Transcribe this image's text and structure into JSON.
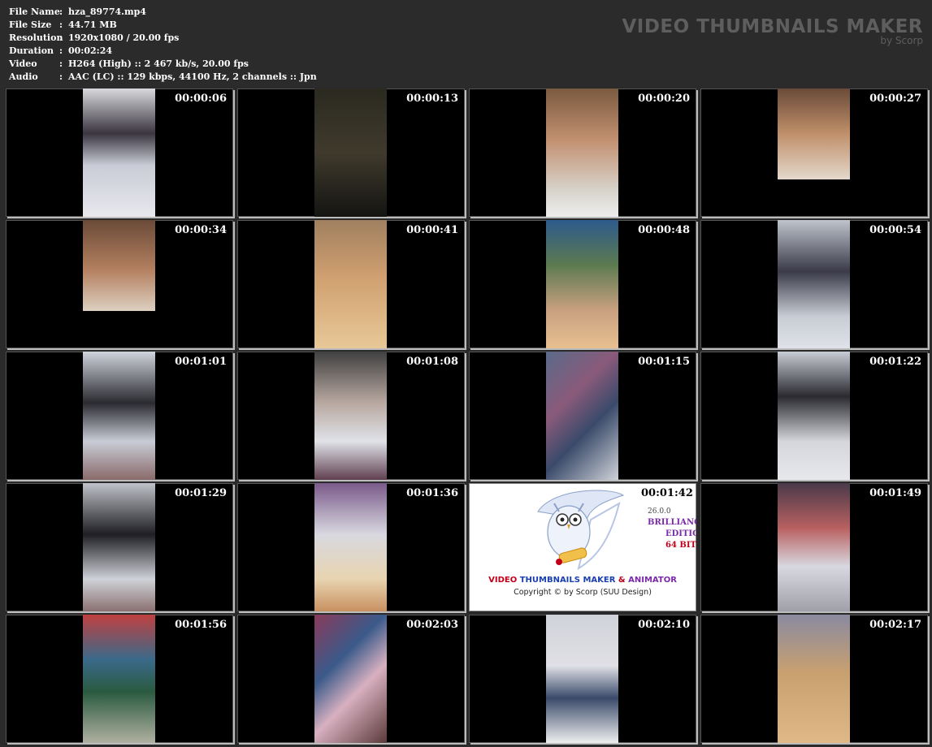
{
  "file_info": [
    {
      "key": "File Name",
      "sep": ":",
      "value": "hza_89774.mp4"
    },
    {
      "key": "File Size",
      "sep": ":",
      "value": "44.71 MB"
    },
    {
      "key": "Resolution",
      "sep": ":",
      "value": "1920x1080 / 20.00 fps"
    },
    {
      "key": "Duration",
      "sep": ":",
      "value": "00:02:24"
    },
    {
      "key": "Video",
      "sep": ":",
      "value": "H264 (High) :: 2 467 kb/s, 20.00 fps"
    },
    {
      "key": "Audio",
      "sep": ":",
      "value": "AAC (LC) :: 129 kbps, 44100 Hz, 2 channels :: Jpn"
    }
  ],
  "brand": {
    "title": "VIDEO THUMBNAILS MAKER",
    "subtitle": "by Scorp"
  },
  "thumbnails": [
    {
      "time": "00:00:06"
    },
    {
      "time": "00:00:13"
    },
    {
      "time": "00:00:20"
    },
    {
      "time": "00:00:27"
    },
    {
      "time": "00:00:34"
    },
    {
      "time": "00:00:41"
    },
    {
      "time": "00:00:48"
    },
    {
      "time": "00:00:54"
    },
    {
      "time": "00:01:01"
    },
    {
      "time": "00:01:08"
    },
    {
      "time": "00:01:15"
    },
    {
      "time": "00:01:22"
    },
    {
      "time": "00:01:29"
    },
    {
      "time": "00:01:36"
    },
    {
      "time": "00:01:42",
      "logo": true
    },
    {
      "time": "00:01:49"
    },
    {
      "time": "00:01:56"
    },
    {
      "time": "00:02:03"
    },
    {
      "time": "00:02:10"
    },
    {
      "time": "00:02:17"
    }
  ],
  "logo_tile": {
    "title_parts": [
      "VIDEO ",
      "THUMBNAILS MAKER",
      " & ",
      "ANIMATOR"
    ],
    "copyright": "Copyright © by Scorp (SUU Design)",
    "side_lines": [
      "26.0.0",
      "BRILLIANCE",
      "EDITION",
      "64 BIT"
    ]
  },
  "colors": {
    "logo_red": "#c0001a",
    "logo_blue": "#1a3fb0",
    "logo_purple": "#7a2aa8"
  }
}
